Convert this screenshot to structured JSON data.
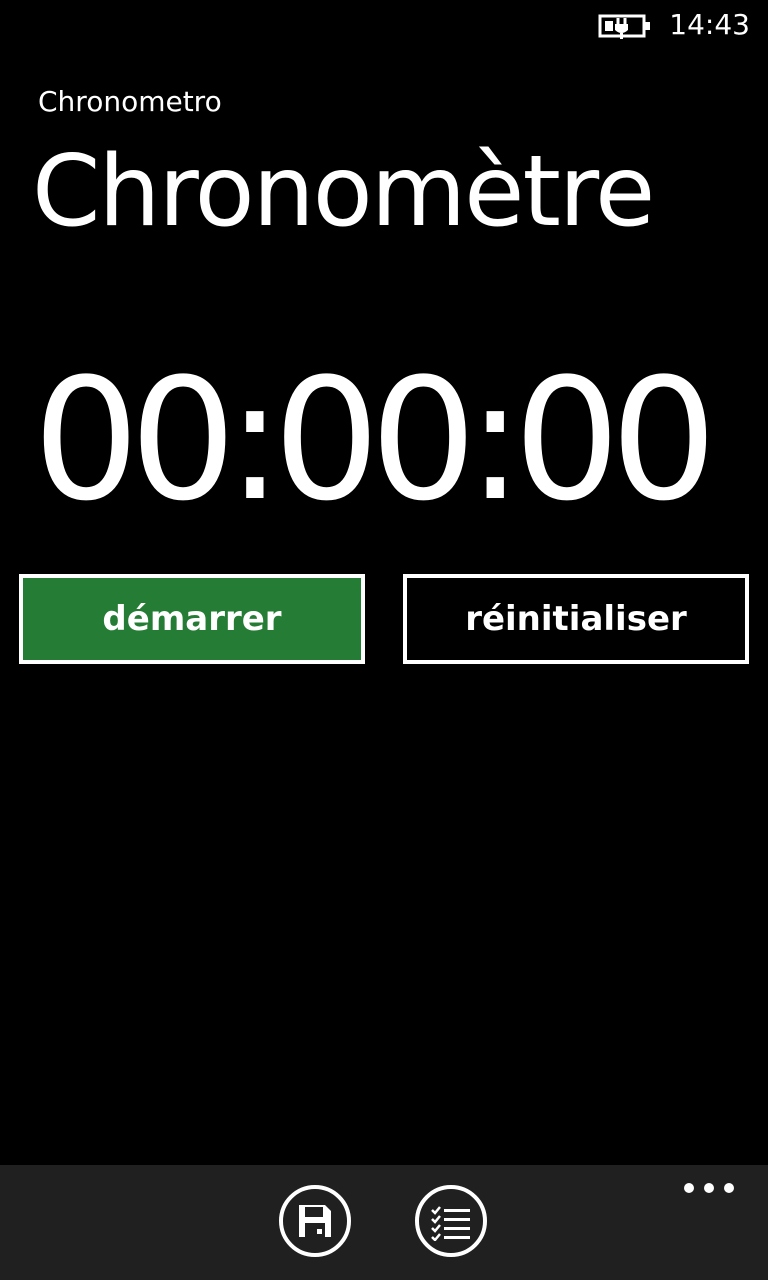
{
  "status_bar": {
    "time": "14:43",
    "battery_icon": "battery-charging-icon"
  },
  "header": {
    "app_name": "Chronometro",
    "page_title": "Chronomètre"
  },
  "timer": {
    "display": "00:00:00"
  },
  "buttons": {
    "start_label": "démarrer",
    "reset_label": "réinitialiser"
  },
  "colors": {
    "background": "#000000",
    "accent": "#257d35",
    "app_bar": "#202020",
    "foreground": "#ffffff"
  },
  "app_bar": {
    "buttons": [
      {
        "icon": "save-icon"
      },
      {
        "icon": "checklist-icon"
      }
    ],
    "more_icon": "ellipsis-icon"
  }
}
